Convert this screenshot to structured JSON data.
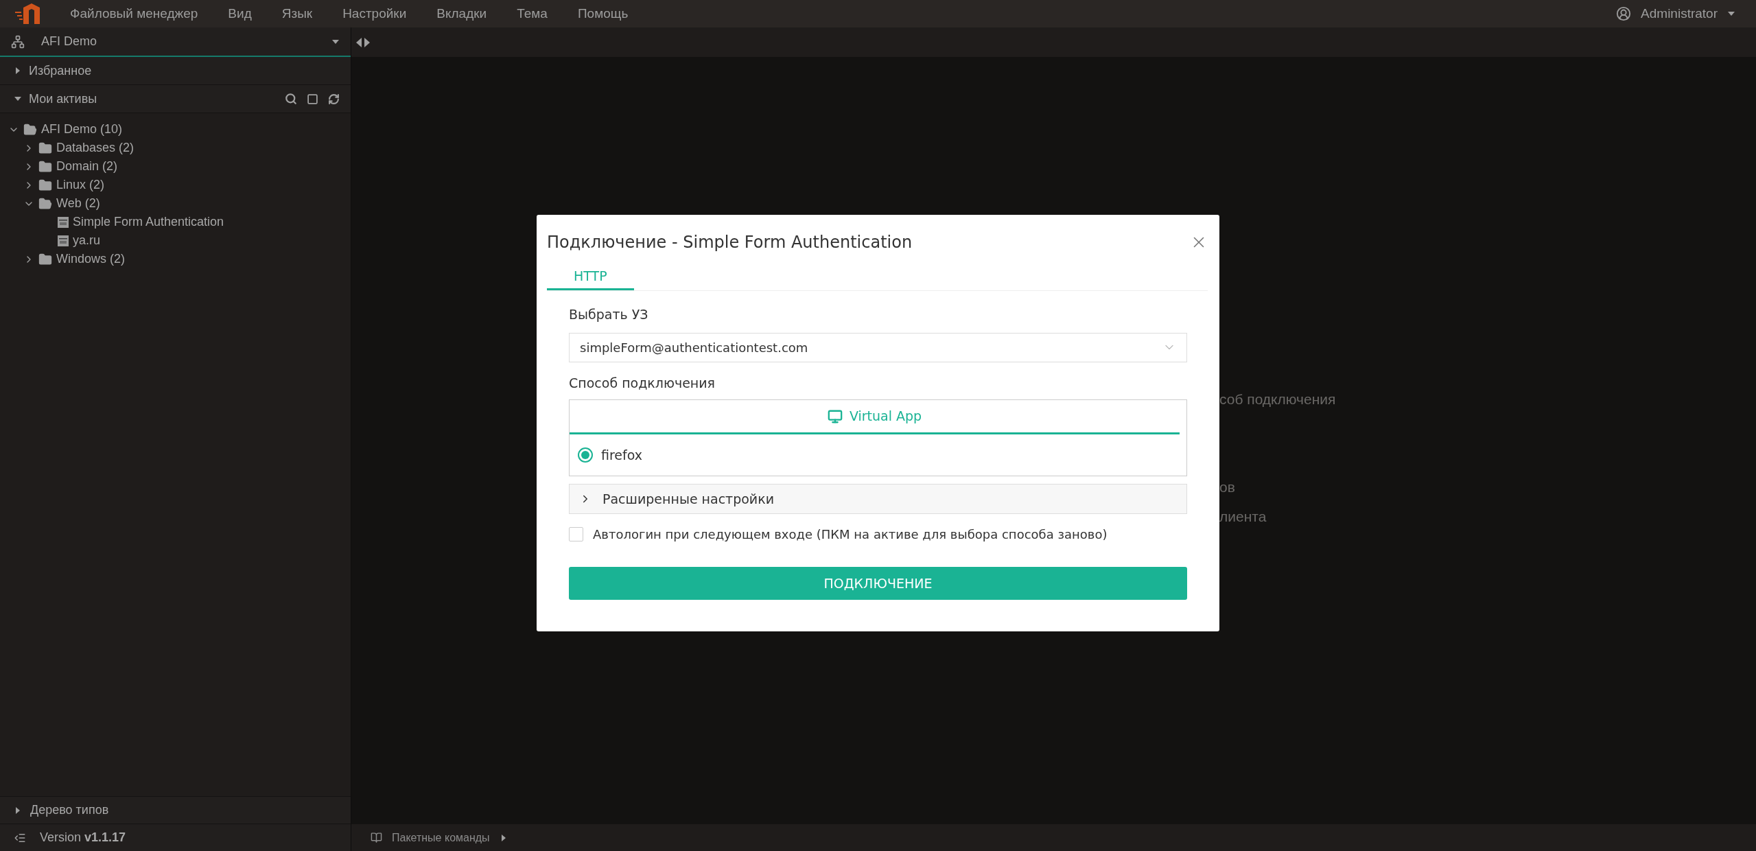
{
  "menu": {
    "items": [
      "Файловый менеджер",
      "Вид",
      "Язык",
      "Настройки",
      "Вкладки",
      "Тема",
      "Помощь"
    ]
  },
  "user": {
    "name": "Administrator"
  },
  "sidebar": {
    "workspace": "AFI Demo",
    "sections": [
      {
        "label": "Избранное",
        "expanded": false
      },
      {
        "label": "Мои активы",
        "expanded": true
      }
    ],
    "tree": [
      {
        "label": "AFI Demo (10)",
        "kind": "folder",
        "expanded": true,
        "children": [
          {
            "label": "Databases (2)",
            "kind": "folder",
            "expanded": false
          },
          {
            "label": "Domain (2)",
            "kind": "folder",
            "expanded": false
          },
          {
            "label": "Linux (2)",
            "kind": "folder",
            "expanded": false
          },
          {
            "label": "Web (2)",
            "kind": "folder",
            "expanded": true,
            "children": [
              {
                "label": "Simple Form Authentication",
                "kind": "asset"
              },
              {
                "label": "ya.ru",
                "kind": "asset"
              }
            ]
          },
          {
            "label": "Windows (2)",
            "kind": "folder",
            "expanded": false
          }
        ]
      }
    ],
    "types_section": {
      "label": "Дерево типов",
      "expanded": false
    },
    "version": "Version **v1.1.17**"
  },
  "bottom_bar": {
    "batch": "Пакетные команды"
  },
  "background_text": [
    "соб подключения",
    "ов",
    "лиента"
  ],
  "dialog": {
    "title": "Подключение - Simple Form Authentication",
    "tabs": [
      {
        "label": "HTTP",
        "selected": true
      }
    ],
    "account_label": "Выбрать УЗ",
    "account_value": "simpleForm@authenticationtest.com",
    "method_label": "Способ подключения",
    "method_tabs": [
      {
        "label": "Virtual App",
        "selected": true
      }
    ],
    "options": [
      {
        "label": "firefox",
        "selected": true
      }
    ],
    "advanced": {
      "label": "Расширенные настройки",
      "expanded": false
    },
    "autologin": {
      "label": "Автологин при следующем входе (ПКМ на активе для выбора способа заново)",
      "checked": false
    },
    "submit": "ПОДКЛЮЧЕНИЕ"
  }
}
